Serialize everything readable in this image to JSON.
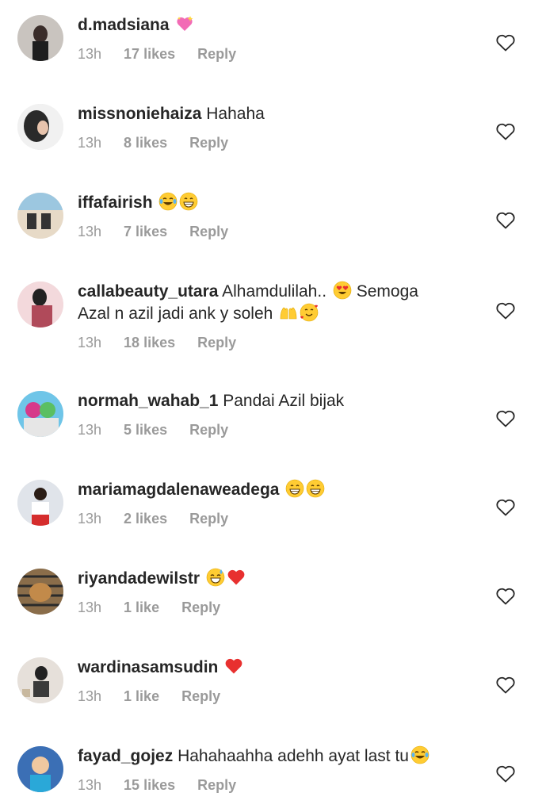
{
  "comments": [
    {
      "username": "d.madsiana",
      "text": "",
      "emoji": [
        "sparkling-heart"
      ],
      "time": "13h",
      "likes": "17 likes",
      "reply": "Reply",
      "avatar_color": "#c9c4bf"
    },
    {
      "username": "missnoniehaiza",
      "text": "Hahaha",
      "emoji": [],
      "time": "13h",
      "likes": "8 likes",
      "reply": "Reply",
      "avatar_color": "#2a2a2a"
    },
    {
      "username": "iffafairish",
      "text": "",
      "emoji": [
        "tears-of-joy",
        "grinning"
      ],
      "time": "13h",
      "likes": "7 likes",
      "reply": "Reply",
      "avatar_color": "#9cc7e0"
    },
    {
      "username": "callabeauty_utara",
      "text": "Alhamdulilah.. ",
      "text2": " Semoga",
      "text_line2": "Azal n azil jadi ank y soleh ",
      "emoji": [
        "heart-eyes"
      ],
      "emoji2": [
        "raising-hands",
        "smiling-hearts"
      ],
      "time": "13h",
      "likes": "18 likes",
      "reply": "Reply",
      "avatar_color": "#b04a5a"
    },
    {
      "username": "normah_wahab_1",
      "text": "Pandai Azil bijak",
      "emoji": [],
      "time": "13h",
      "likes": "5 likes",
      "reply": "Reply",
      "avatar_color": "#d63a8a"
    },
    {
      "username": "mariamagdalenaweadega",
      "text": "",
      "emoji": [
        "grinning",
        "grinning"
      ],
      "time": "13h",
      "likes": "2 likes",
      "reply": "Reply",
      "avatar_color": "#e0e4ea"
    },
    {
      "username": "riyandadewilstr",
      "text": "",
      "emoji": [
        "sweat-smile",
        "red-heart"
      ],
      "time": "13h",
      "likes": "1 like",
      "reply": "Reply",
      "avatar_color": "#8a6d4a"
    },
    {
      "username": "wardinasamsudin",
      "text": "",
      "emoji": [
        "red-heart"
      ],
      "time": "13h",
      "likes": "1 like",
      "reply": "Reply",
      "avatar_color": "#e6e0da"
    },
    {
      "username": "fayad_gojez",
      "text": "Hahahaahha adehh ayat last tu",
      "emoji": [
        "tears-of-joy"
      ],
      "time": "13h",
      "likes": "15 likes",
      "reply": "Reply",
      "avatar_color": "#3b6fb5"
    }
  ],
  "colors": {
    "text": "#262626",
    "meta": "#9a9a9a",
    "heart_outline": "#262626"
  }
}
